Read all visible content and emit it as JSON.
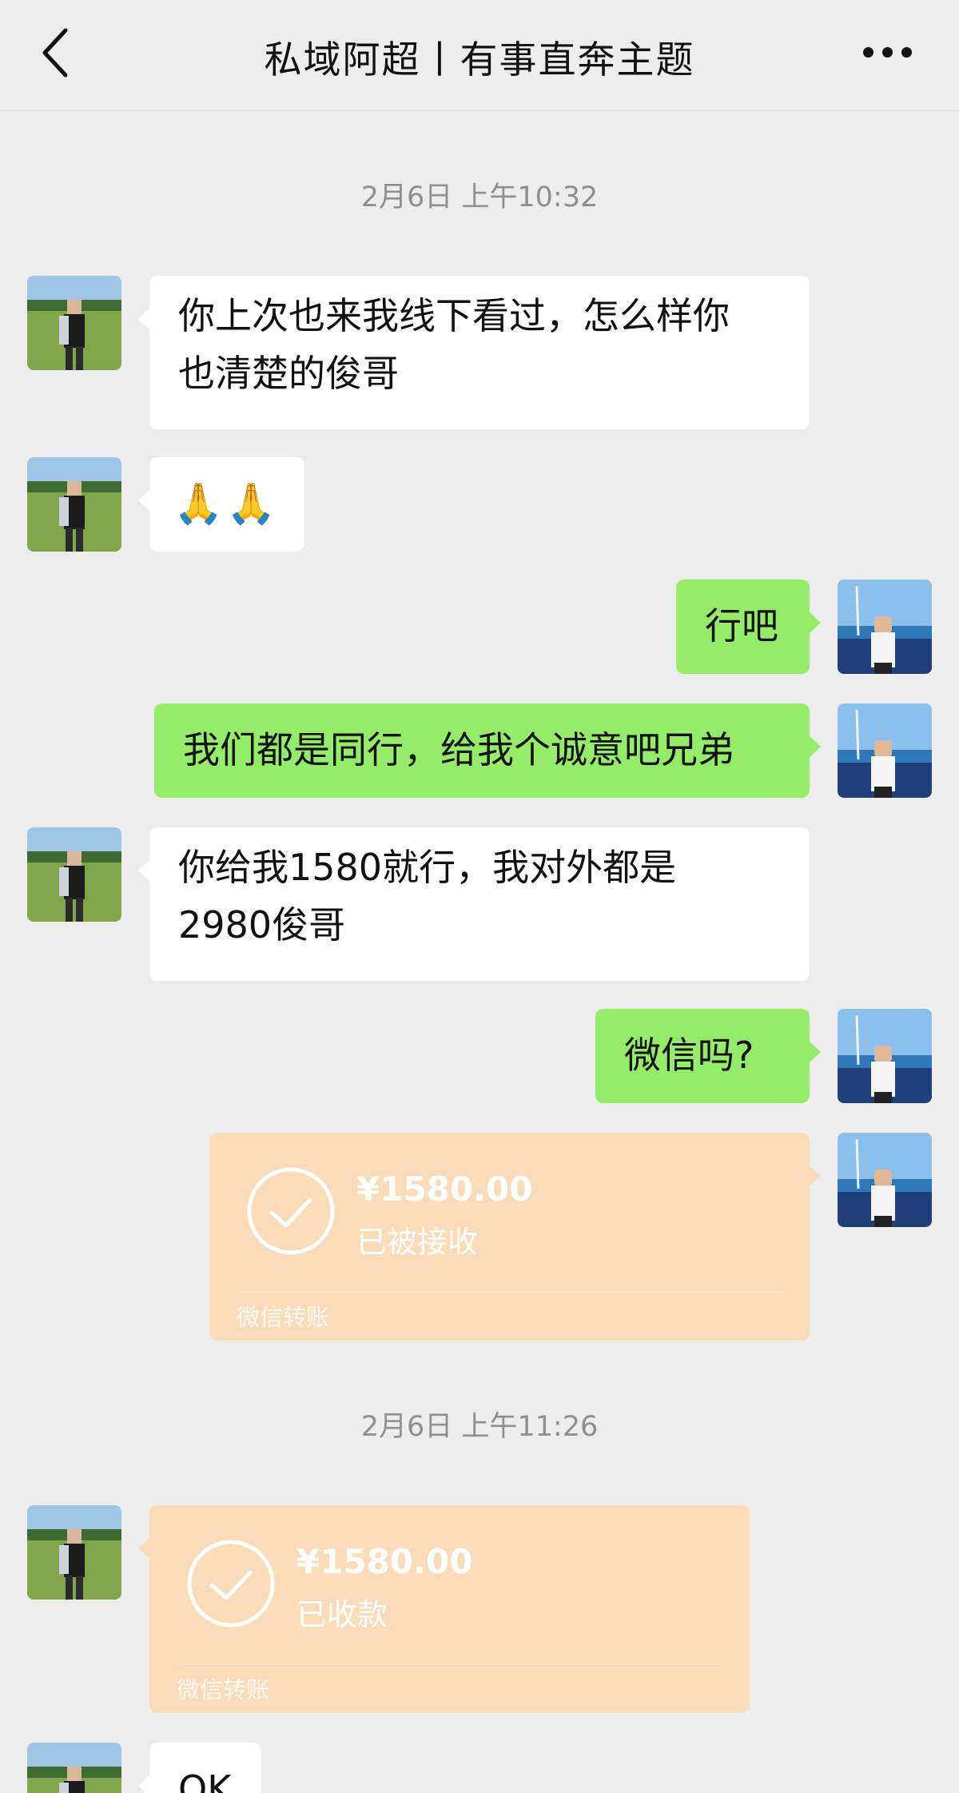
{
  "header": {
    "title": "私域阿超丨有事直奔主题",
    "back_icon": "chevron-left-icon",
    "more_icon": "more-horizontal-icon"
  },
  "timestamps": [
    "2月6日 上午10:32",
    "2月6日 上午11:26"
  ],
  "messages": [
    {
      "side": "left",
      "type": "text",
      "text": "你上次也来我线下看过，怎么样你\n也清楚的俊哥"
    },
    {
      "side": "left",
      "type": "emoji",
      "text": "🙏🙏"
    },
    {
      "side": "right",
      "type": "text",
      "text": "行吧"
    },
    {
      "side": "right",
      "type": "text",
      "text": "我们都是同行，给我个诚意吧兄弟"
    },
    {
      "side": "left",
      "type": "text",
      "text": "你给我1580就行，我对外都是\n2980俊哥"
    },
    {
      "side": "right",
      "type": "text",
      "text": "微信吗?"
    },
    {
      "side": "right",
      "type": "transfer",
      "amount": "¥1580.00",
      "status": "已被接收",
      "label": "微信转账"
    },
    {
      "side": "left",
      "type": "transfer",
      "amount": "¥1580.00",
      "status": "已收款",
      "label": "微信转账"
    },
    {
      "side": "left",
      "type": "text",
      "text": "OK"
    }
  ],
  "colors": {
    "background": "#ededed",
    "bubble_green": "#95ec69",
    "bubble_white": "#ffffff",
    "transfer_received": "#fadcb8"
  }
}
